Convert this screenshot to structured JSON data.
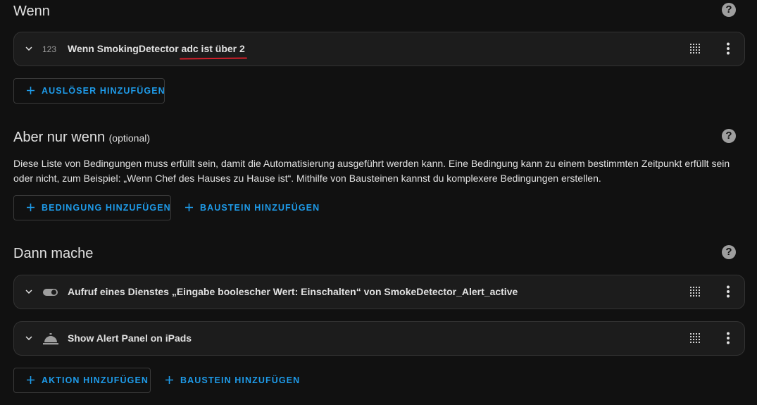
{
  "sections": {
    "triggers": {
      "title": "Wenn",
      "items": [
        {
          "icon": "numeric-icon",
          "icon_text": "123",
          "title_prefix": "Wenn SmokingDetector ",
          "title_highlight": "adc ist über 2"
        }
      ],
      "add_button": "AUSLÖSER HINZUFÜGEN"
    },
    "conditions": {
      "title": "Aber nur wenn",
      "optional_label": "(optional)",
      "description": "Diese Liste von Bedingungen muss erfüllt sein, damit die Automatisierung ausgeführt werden kann. Eine Bedingung kann zu einem bestimmten Zeitpunkt erfüllt sein oder nicht, zum Beispiel: „Wenn Chef des Hauses zu Hause ist“. Mithilfe von Bausteinen kannst du komplexere Bedingungen erstellen.",
      "add_button": "BEDINGUNG HINZUFÜGEN",
      "block_button": "BAUSTEIN HINZUFÜGEN"
    },
    "actions": {
      "title": "Dann mache",
      "items": [
        {
          "icon": "toggle-switch-icon",
          "title": "Aufruf eines Dienstes „Eingabe boolescher Wert: Einschalten“ von SmokeDetector_Alert_active"
        },
        {
          "icon": "bell-concierge-icon",
          "title": "Show Alert Panel on iPads"
        }
      ],
      "add_button": "AKTION HINZUFÜGEN",
      "block_button": "BAUSTEIN HINZUFÜGEN"
    }
  },
  "help_icon_glyph": "?",
  "colors": {
    "background": "#111111",
    "card": "#1c1c1c",
    "accent": "#1e9be9",
    "annotation": "#d3202a",
    "text": "#e1e1e1",
    "icon": "#9e9e9e"
  }
}
